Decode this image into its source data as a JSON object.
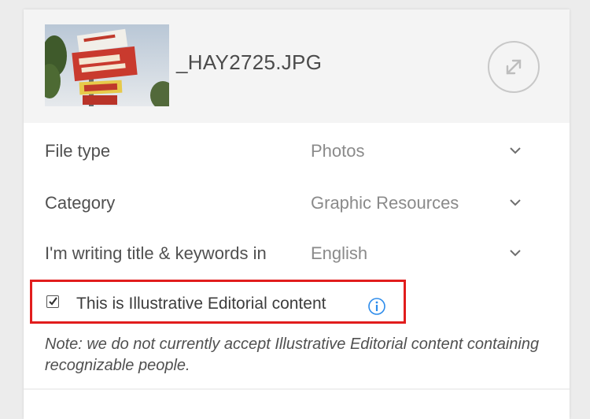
{
  "file": {
    "name": "_HAY2725.JPG",
    "thumbnail_icon": "photo-thumbnail"
  },
  "fields": [
    {
      "label": "File type",
      "value": "Photos"
    },
    {
      "label": "Category",
      "value": "Graphic Resources"
    },
    {
      "label": "I'm writing title & keywords in",
      "value": "English"
    }
  ],
  "editorial": {
    "label": "This is Illustrative Editorial content",
    "checked": true,
    "note": "Note: we do not currently accept Illustrative Editorial content containing recognizable people."
  },
  "colors": {
    "highlight": "#e11d1d",
    "info": "#2d8ceb"
  }
}
